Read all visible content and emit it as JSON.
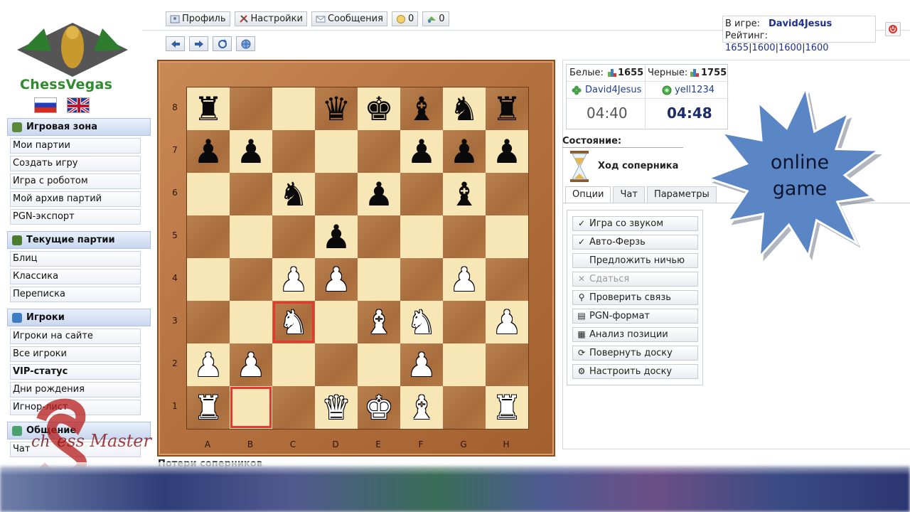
{
  "brand": {
    "logo_text": "ChessVegas",
    "flags": [
      "ru-flag",
      "uk-flag"
    ]
  },
  "toolbar": {
    "buttons": [
      {
        "label": "Профиль",
        "icon": "profile-icon"
      },
      {
        "label": "Настройки",
        "icon": "settings-icon"
      },
      {
        "label": "Сообщения",
        "icon": "messages-icon"
      },
      {
        "label": "0",
        "icon": "coin-icon"
      },
      {
        "label": "0",
        "icon": "gift-icon"
      }
    ],
    "nav": [
      "arrow-left-icon",
      "arrow-right-icon",
      "refresh-icon",
      "globe-icon"
    ]
  },
  "userbox": {
    "in_game_label": "В игре:",
    "nick": "David4Jesus",
    "rating_label": "Рейтинг:",
    "ratings": [
      "1655",
      "1600",
      "1600",
      "1600"
    ]
  },
  "sidebar": {
    "sections": [
      {
        "title": "Игровая зона",
        "icon_color": "#5a8a3a",
        "items": [
          "Мои партии",
          "Создать игру",
          "Игра с роботом",
          "Мой архив партий",
          "PGN-экспорт"
        ]
      },
      {
        "title": "Текущие партии",
        "icon_color": "#4a7d2a",
        "items": [
          "Блиц",
          "Классика",
          "Переписка"
        ]
      },
      {
        "title": "Игроки",
        "icon_color": "#3d7ec4",
        "items": [
          "Игроки на сайте",
          "Все игроки",
          "VIP-статус",
          "Дни рождения",
          "Игнор-лист"
        ]
      },
      {
        "title": "Общение",
        "icon_color": "#4aa06b",
        "items": [
          "Чат"
        ]
      }
    ]
  },
  "board": {
    "files": [
      "A",
      "B",
      "C",
      "D",
      "E",
      "F",
      "G",
      "H"
    ],
    "ranks": [
      "8",
      "7",
      "6",
      "5",
      "4",
      "3",
      "2",
      "1"
    ],
    "highlight_squares": [
      "c3",
      "b1"
    ],
    "position": [
      [
        "r",
        "",
        "",
        "q",
        "k",
        "b",
        "n",
        "r"
      ],
      [
        "p",
        "p",
        "",
        "",
        "",
        "p",
        "p",
        "p"
      ],
      [
        "",
        "",
        "n",
        "",
        "p",
        "",
        "b",
        ""
      ],
      [
        "",
        "",
        "",
        "p",
        "",
        "",
        "",
        ""
      ],
      [
        "",
        "",
        "P",
        "P",
        "",
        "",
        "P",
        ""
      ],
      [
        "",
        "",
        "N",
        "",
        "B",
        "N",
        "",
        "P"
      ],
      [
        "P",
        "P",
        "",
        "",
        "",
        "P",
        "",
        ""
      ],
      [
        "R",
        "",
        "",
        "Q",
        "K",
        "B",
        "",
        "R"
      ]
    ],
    "losses_title": "Потери соперников"
  },
  "score": {
    "white_label": "Белые:",
    "white_rating": "1655",
    "black_label": "Черные:",
    "black_rating": "1755",
    "white_player": "David4Jesus",
    "black_player": "yell1234",
    "white_clock": "04:40",
    "black_clock": "04:48"
  },
  "state": {
    "label": "Состояние:",
    "text": "Ход соперника"
  },
  "tabs": [
    "Опции",
    "Чат",
    "Параметры"
  ],
  "options": [
    {
      "label": "Игра со звуком",
      "icon": "check-icon",
      "glyph": "✓",
      "disabled": false
    },
    {
      "label": "Авто-Ферзь",
      "icon": "check-icon",
      "glyph": "✓",
      "disabled": false
    },
    {
      "label": "Предложить ничью",
      "icon": "",
      "glyph": "",
      "disabled": false
    },
    {
      "label": "Сдаться",
      "icon": "resign-x-icon",
      "glyph": "✕",
      "disabled": true
    },
    {
      "label": "Проверить связь",
      "icon": "connection-icon",
      "glyph": "⚲",
      "disabled": false
    },
    {
      "label": "PGN-формат",
      "icon": "document-icon",
      "glyph": "▤",
      "disabled": false
    },
    {
      "label": "Анализ позиции",
      "icon": "analysis-icon",
      "glyph": "▦",
      "disabled": false
    },
    {
      "label": "Повернуть доску",
      "icon": "rotate-icon",
      "glyph": "⟳",
      "disabled": false
    },
    {
      "label": "Настроить доску",
      "icon": "gears-icon",
      "glyph": "⚙",
      "disabled": false
    }
  ],
  "overlay": {
    "line1": "online",
    "line2": "game",
    "color": "#5a86c5"
  },
  "watermark": {
    "text": "ess Master",
    "letters": "ch"
  }
}
